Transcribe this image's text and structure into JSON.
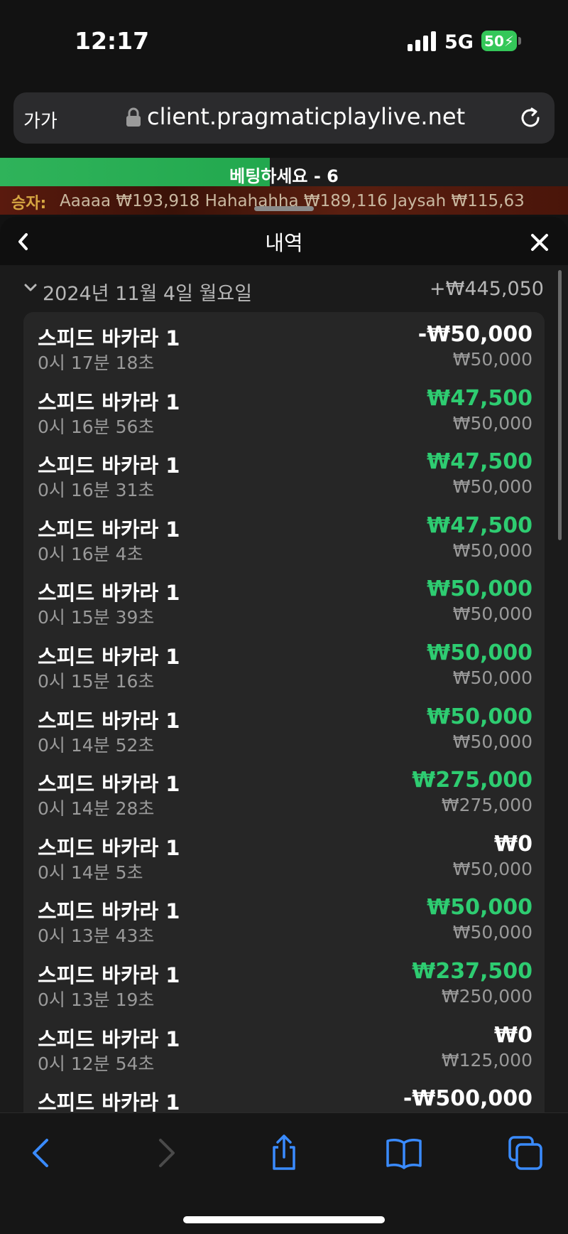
{
  "status": {
    "time": "12:17",
    "network": "5G",
    "battery": "50"
  },
  "browser": {
    "text_size_label": "가가",
    "url": "client.pragmaticplaylive.net"
  },
  "game_bar": {
    "bet_prompt": "베팅하세요 - 6",
    "winners_label": "승자:",
    "winners_ticker": "Aaaaa   ₩193,918 Hahahahha   ₩189,116 Jaysah   ₩115,63"
  },
  "history": {
    "title": "내역",
    "date_label": "2024년 11월 4일 월요일",
    "date_total": "+₩445,050",
    "items": [
      {
        "game": "스피드 바카라 1",
        "time": "0시 17분 18초",
        "amount": "-₩50,000",
        "stake": "₩50,000",
        "positive": false
      },
      {
        "game": "스피드 바카라 1",
        "time": "0시 16분 56초",
        "amount": "₩47,500",
        "stake": "₩50,000",
        "positive": true
      },
      {
        "game": "스피드 바카라 1",
        "time": "0시 16분 31초",
        "amount": "₩47,500",
        "stake": "₩50,000",
        "positive": true
      },
      {
        "game": "스피드 바카라 1",
        "time": "0시 16분 4초",
        "amount": "₩47,500",
        "stake": "₩50,000",
        "positive": true
      },
      {
        "game": "스피드 바카라 1",
        "time": "0시 15분 39초",
        "amount": "₩50,000",
        "stake": "₩50,000",
        "positive": true
      },
      {
        "game": "스피드 바카라 1",
        "time": "0시 15분 16초",
        "amount": "₩50,000",
        "stake": "₩50,000",
        "positive": true
      },
      {
        "game": "스피드 바카라 1",
        "time": "0시 14분 52초",
        "amount": "₩50,000",
        "stake": "₩50,000",
        "positive": true
      },
      {
        "game": "스피드 바카라 1",
        "time": "0시 14분 28초",
        "amount": "₩275,000",
        "stake": "₩275,000",
        "positive": true
      },
      {
        "game": "스피드 바카라 1",
        "time": "0시 14분 5초",
        "amount": "₩0",
        "stake": "₩50,000",
        "positive": false
      },
      {
        "game": "스피드 바카라 1",
        "time": "0시 13분 43초",
        "amount": "₩50,000",
        "stake": "₩50,000",
        "positive": true
      },
      {
        "game": "스피드 바카라 1",
        "time": "0시 13분 19초",
        "amount": "₩237,500",
        "stake": "₩250,000",
        "positive": true
      },
      {
        "game": "스피드 바카라 1",
        "time": "0시 12분 54초",
        "amount": "₩0",
        "stake": "₩125,000",
        "positive": false
      },
      {
        "game": "스피드 바카라 1",
        "time": "",
        "amount": "-₩500,000",
        "stake": "",
        "positive": false
      }
    ]
  },
  "colors": {
    "positive": "#2ecc71",
    "accent_blue": "#3a8bff",
    "bet_bar": "#2fb35a"
  },
  "icons": [
    "lock-icon",
    "reload-icon",
    "back-icon",
    "close-icon",
    "chevron-down-icon",
    "share-icon",
    "bookmarks-icon",
    "tabs-icon"
  ]
}
